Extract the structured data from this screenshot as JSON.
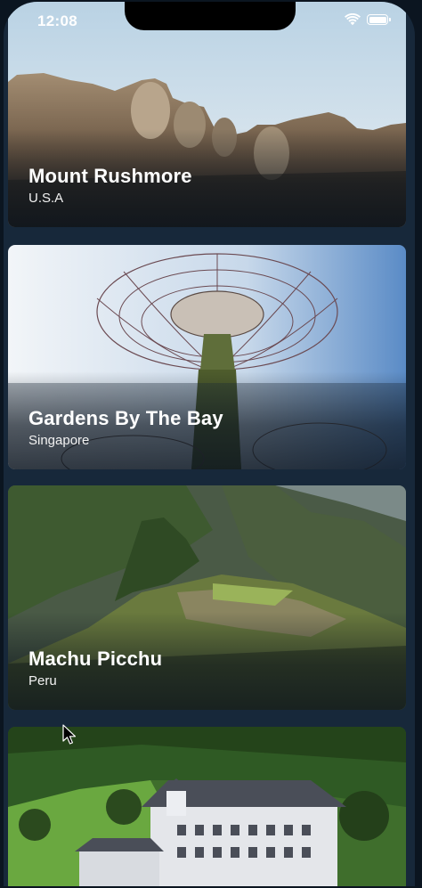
{
  "status_bar": {
    "time": "12:08",
    "wifi_icon": "wifi-icon",
    "battery_icon": "battery-icon"
  },
  "places": [
    {
      "title": "Mount Rushmore",
      "subtitle": "U.S.A",
      "image": "mount-rushmore-photo"
    },
    {
      "title": "Gardens By The Bay",
      "subtitle": "Singapore",
      "image": "supertree-photo"
    },
    {
      "title": "Machu Picchu",
      "subtitle": "Peru",
      "image": "machu-picchu-photo"
    },
    {
      "title": "",
      "subtitle": "",
      "image": "mountain-hotel-photo"
    }
  ],
  "colors": {
    "background": "#17283a",
    "text": "#ffffff"
  }
}
